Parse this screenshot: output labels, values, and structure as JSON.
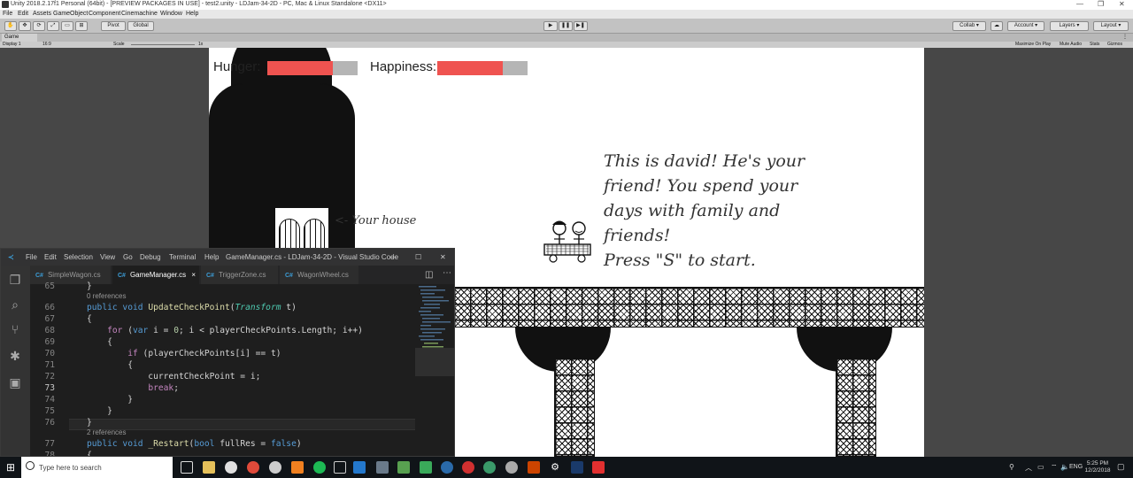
{
  "unity": {
    "title": "Unity 2018.2.17f1 Personal (64bit) - [PREVIEW PACKAGES IN USE] - test2.unity - LDJam-34-2D - PC, Mac & Linux Standalone <DX11>",
    "menu": [
      "File",
      "Edit",
      "Assets",
      "GameObject",
      "Component",
      "Cinemachine",
      "Window",
      "Help"
    ],
    "toolbar": {
      "pivot": "Pivot",
      "global": "Global",
      "collab": "Collab",
      "account": "Account",
      "layers": "Layers",
      "layout": "Layout"
    },
    "game_tab": "Game",
    "game_controls": {
      "display": "Display 1",
      "aspect": "16:9",
      "scale_label": "Scale",
      "scale_value": "1x",
      "maximize": "Maximize On Play",
      "mute": "Mute Audio",
      "stats": "Stats",
      "gizmos": "Gizmos"
    }
  },
  "game": {
    "hunger_label": "Hunger:",
    "happiness_label": "Happiness:",
    "hunger_level": 0.73,
    "happiness_level": 0.73,
    "house_label": "<- Your house",
    "story_lines": [
      "This is david! He's your",
      "friend! You spend your",
      "days with family and",
      "friends!",
      "Press \"S\" to start."
    ]
  },
  "vscode": {
    "menu": [
      "File",
      "Edit",
      "Selection",
      "View",
      "Go",
      "Debug",
      "Terminal",
      "Help"
    ],
    "title": "GameManager.cs - LDJam-34-2D - Visual Studio Code",
    "tabs": [
      {
        "label": "SimpleWagon.cs",
        "active": false
      },
      {
        "label": "GameManager.cs",
        "active": true
      },
      {
        "label": "TriggerZone.cs",
        "active": false
      },
      {
        "label": "WagonWheel.cs",
        "active": false
      }
    ],
    "tab_close": "×",
    "code": {
      "ln65": "65",
      "ln66": "66",
      "ln67": "67",
      "ln68": "68",
      "ln69": "69",
      "ln70": "70",
      "ln71": "71",
      "ln72": "72",
      "ln73": "73",
      "ln74": "74",
      "ln75": "75",
      "ln76": "76",
      "ln77": "77",
      "ln78": "78",
      "refs0": "0 references",
      "refs2": "2 references"
    }
  },
  "taskbar": {
    "search_placeholder": "Type here to search",
    "language": "ENG",
    "time": "5:25 PM",
    "date": "12/2/2018"
  }
}
